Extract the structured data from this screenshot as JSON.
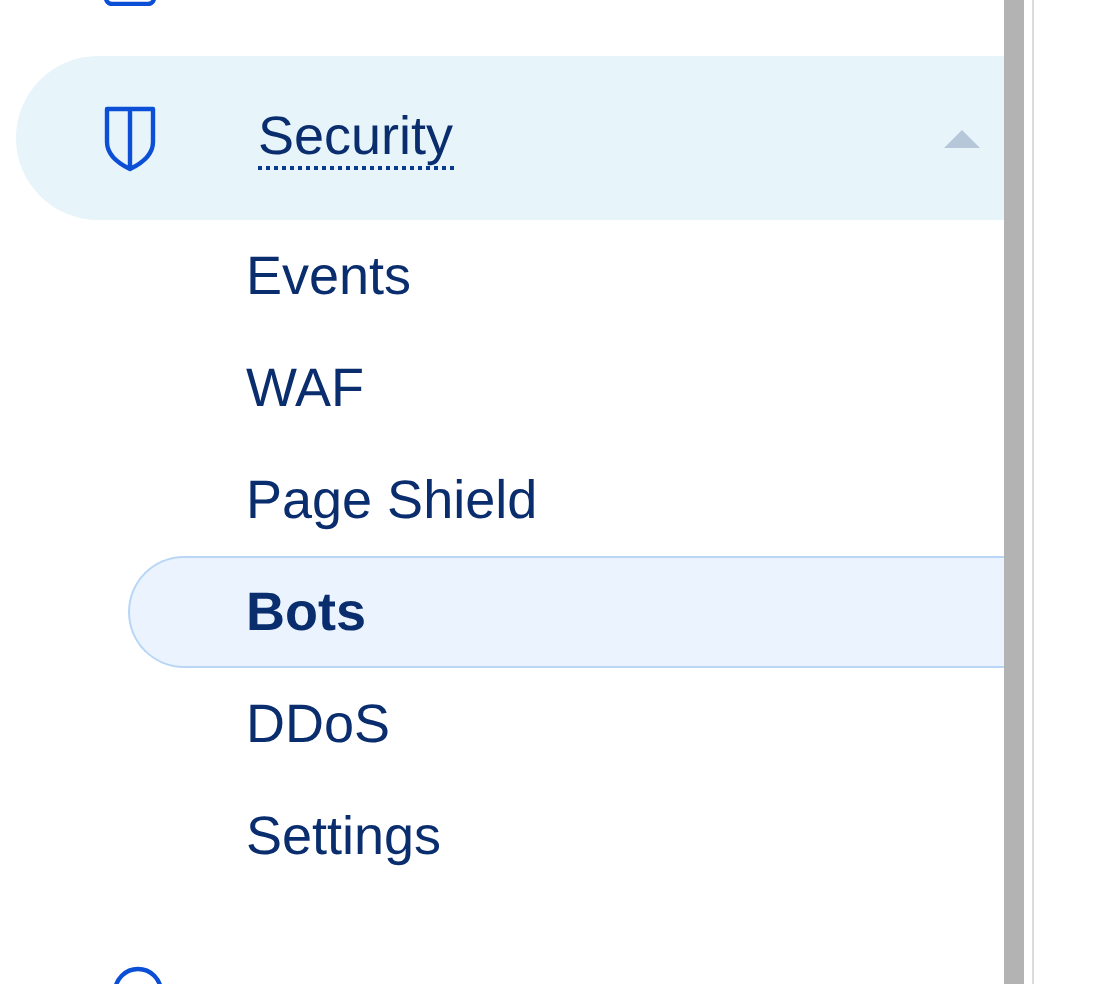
{
  "section": {
    "label": "Security",
    "expanded": true,
    "selected": true,
    "children": [
      {
        "label": "Events",
        "selected": false
      },
      {
        "label": "WAF",
        "selected": false
      },
      {
        "label": "Page Shield",
        "selected": false
      },
      {
        "label": "Bots",
        "selected": true
      },
      {
        "label": "DDoS",
        "selected": false
      },
      {
        "label": "Settings",
        "selected": false
      }
    ]
  }
}
